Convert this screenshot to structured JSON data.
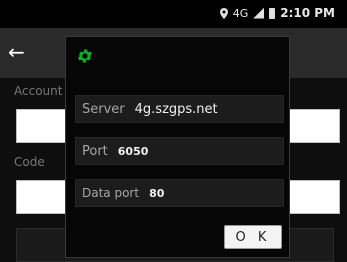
{
  "status_bar": {
    "network": "4G",
    "time": "2:10 PM",
    "location_icon": "location-pin-icon",
    "signal_icon": "signal-icon",
    "battery_icon": "battery-icon"
  },
  "app": {
    "back_icon": "back-arrow-icon",
    "account_label": "Account",
    "code_label": "Code"
  },
  "dialog": {
    "icon": "gear-icon",
    "icon_color": "#19a52b",
    "server_label": "Server",
    "server_value": "4g.szgps.net",
    "port_label": "Port",
    "port_value": "6050",
    "data_port_label": "Data port",
    "data_port_value": "80",
    "ok_label": "O K"
  }
}
